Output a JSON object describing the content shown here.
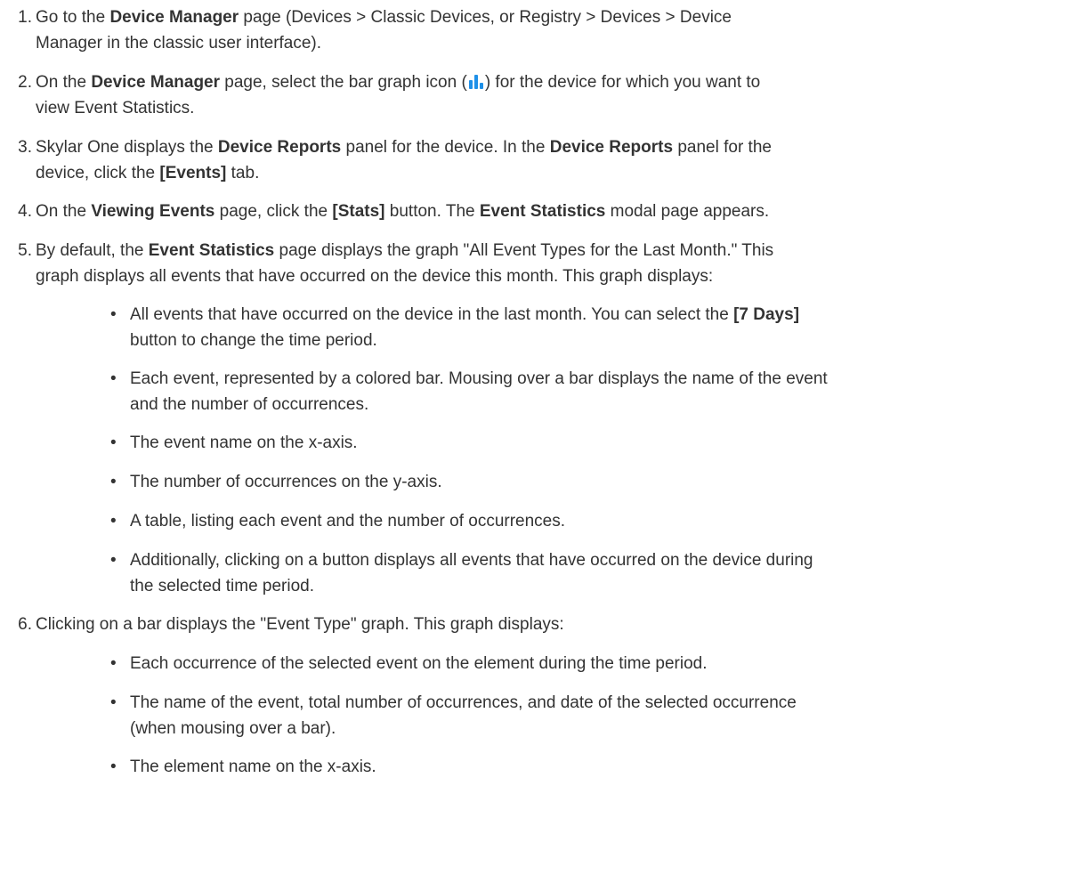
{
  "steps": {
    "s1": {
      "num": "1.",
      "a": "Go to the ",
      "b1": "Device Manager",
      "c": " page (Devices > Classic Devices, or Registry > Devices > Device",
      "line2": "Manager in the classic user interface)."
    },
    "s2": {
      "num": "2.",
      "a": "On the ",
      "b1": "Device Manager",
      "c": " page, select the bar graph icon (",
      "d": ") for the device for which you want to",
      "line2": "view Event Statistics."
    },
    "s3": {
      "num": "3.",
      "a": "Skylar One displays the ",
      "b1": "Device Reports",
      "c": " panel for the device. In the ",
      "b2": "Device Reports",
      "d": " panel for the",
      "line2a": "device, click the ",
      "b3": "[Events]",
      "line2b": " tab."
    },
    "s4": {
      "num": "4.",
      "a": " On the ",
      "b1": "Viewing Events",
      "c": " page, click the ",
      "b2": "[Stats]",
      "d": " button. The ",
      "b3": "Event Statistics",
      "e": " modal page appears."
    },
    "s5": {
      "num": "5.",
      "a": "By default, the ",
      "b1": "Event Statistics",
      "c": " page displays the graph \"All Event Types for the Last Month.\" This",
      "line2": "graph displays all events that have occurred on the device this month. This graph displays:"
    },
    "s6": {
      "num": "6.",
      "text": "Clicking on a bar displays the \"Event Type\" graph. This graph displays:"
    }
  },
  "bullets5": {
    "b1": {
      "l1a": "All events that have occurred on the device in the last month. You can select the ",
      "l1b": "[7 Days]",
      "l2": "button to change the time period."
    },
    "b2": {
      "l1": "Each event, represented by a colored bar. Mousing over a bar displays the name of the event",
      "l2": "and the number of occurrences."
    },
    "b3": {
      "l1": "The event name on the x-axis."
    },
    "b4": {
      "l1": "The number of occurrences on the y-axis."
    },
    "b5": {
      "l1": "A table, listing each event and the number of occurrences."
    },
    "b6": {
      "l1": "Additionally, clicking on a button displays all events that have occurred on the device during",
      "l2": "the selected time period."
    }
  },
  "bullets6": {
    "b1": {
      "l1": "Each occurrence of the selected event on the element during the time period."
    },
    "b2": {
      "l1": " The name of the event, total number of occurrences, and date of the selected occurrence",
      "l2": "(when mousing over a bar)."
    },
    "b3": {
      "l1": "The element name on the x-axis."
    }
  },
  "bullet_char": "•",
  "icon": {
    "name": "bar-graph-icon",
    "color": "#1e90e8"
  }
}
